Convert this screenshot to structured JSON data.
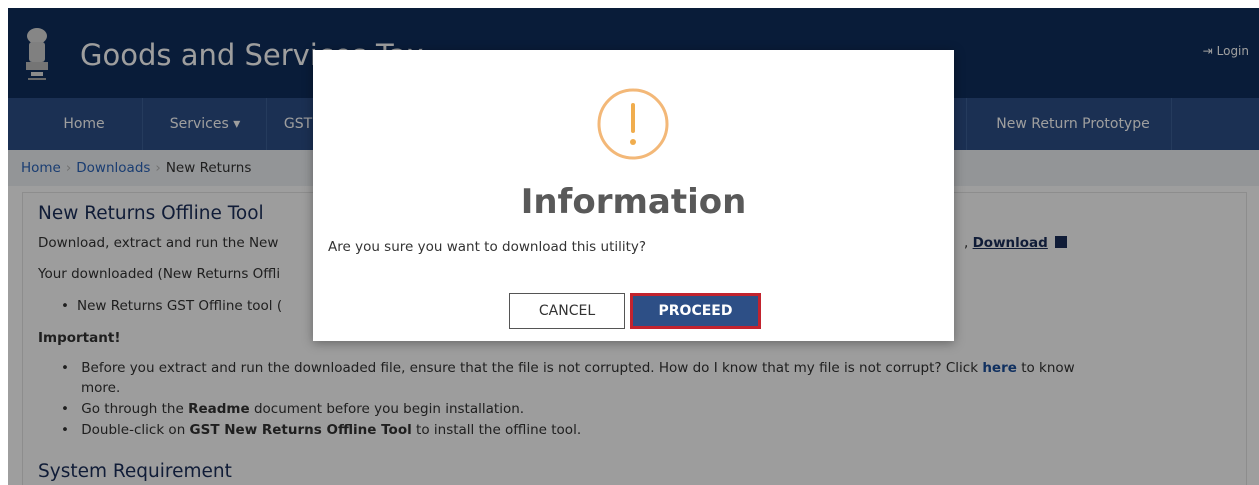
{
  "header": {
    "title": "Goods and Services Tax",
    "login_label": "Login",
    "emblem_icon": "state-emblem-icon"
  },
  "nav": {
    "items": [
      {
        "label": "Home"
      },
      {
        "label": "Services ▾"
      },
      {
        "label": "GST"
      },
      {
        "label": "New Return Prototype"
      }
    ]
  },
  "breadcrumb": {
    "items": [
      "Home",
      "Downloads",
      "New Returns"
    ]
  },
  "content": {
    "title": "New Returns Offline Tool",
    "line1_prefix": "Download, extract and run the New",
    "download_link": "Download",
    "line2_prefix": "Your downloaded (New Returns Offli",
    "bullet1_prefix": "New Returns GST Offline tool (",
    "important_label": "Important!",
    "bullets": {
      "extract_text": "Before you extract and run the downloaded file, ensure that the file is not corrupted. How do I know that my file is not corrupt? Click",
      "extract_link": "here",
      "extract_suffix": "to know",
      "extract_cont": "more.",
      "readme_pre": "Go through the",
      "readme_bold": "Readme",
      "readme_post": "document before you begin installation.",
      "dbl_pre": "Double-click on",
      "dbl_bold": "GST New Returns Offline Tool",
      "dbl_post": "to install the offline tool."
    },
    "system_req_title": "System Requirement"
  },
  "modal": {
    "icon": "exclamation-circle-icon",
    "title": "Information",
    "message": "Are you sure you want to download this utility?",
    "cancel_label": "CANCEL",
    "proceed_label": "PROCEED"
  },
  "colors": {
    "header_bg": "#0f2e5c",
    "navbar_bg": "#2c4e86",
    "warning_orange": "#f0ad4e",
    "proceed_bg": "#2d4f86",
    "proceed_highlight": "#c2232e"
  }
}
